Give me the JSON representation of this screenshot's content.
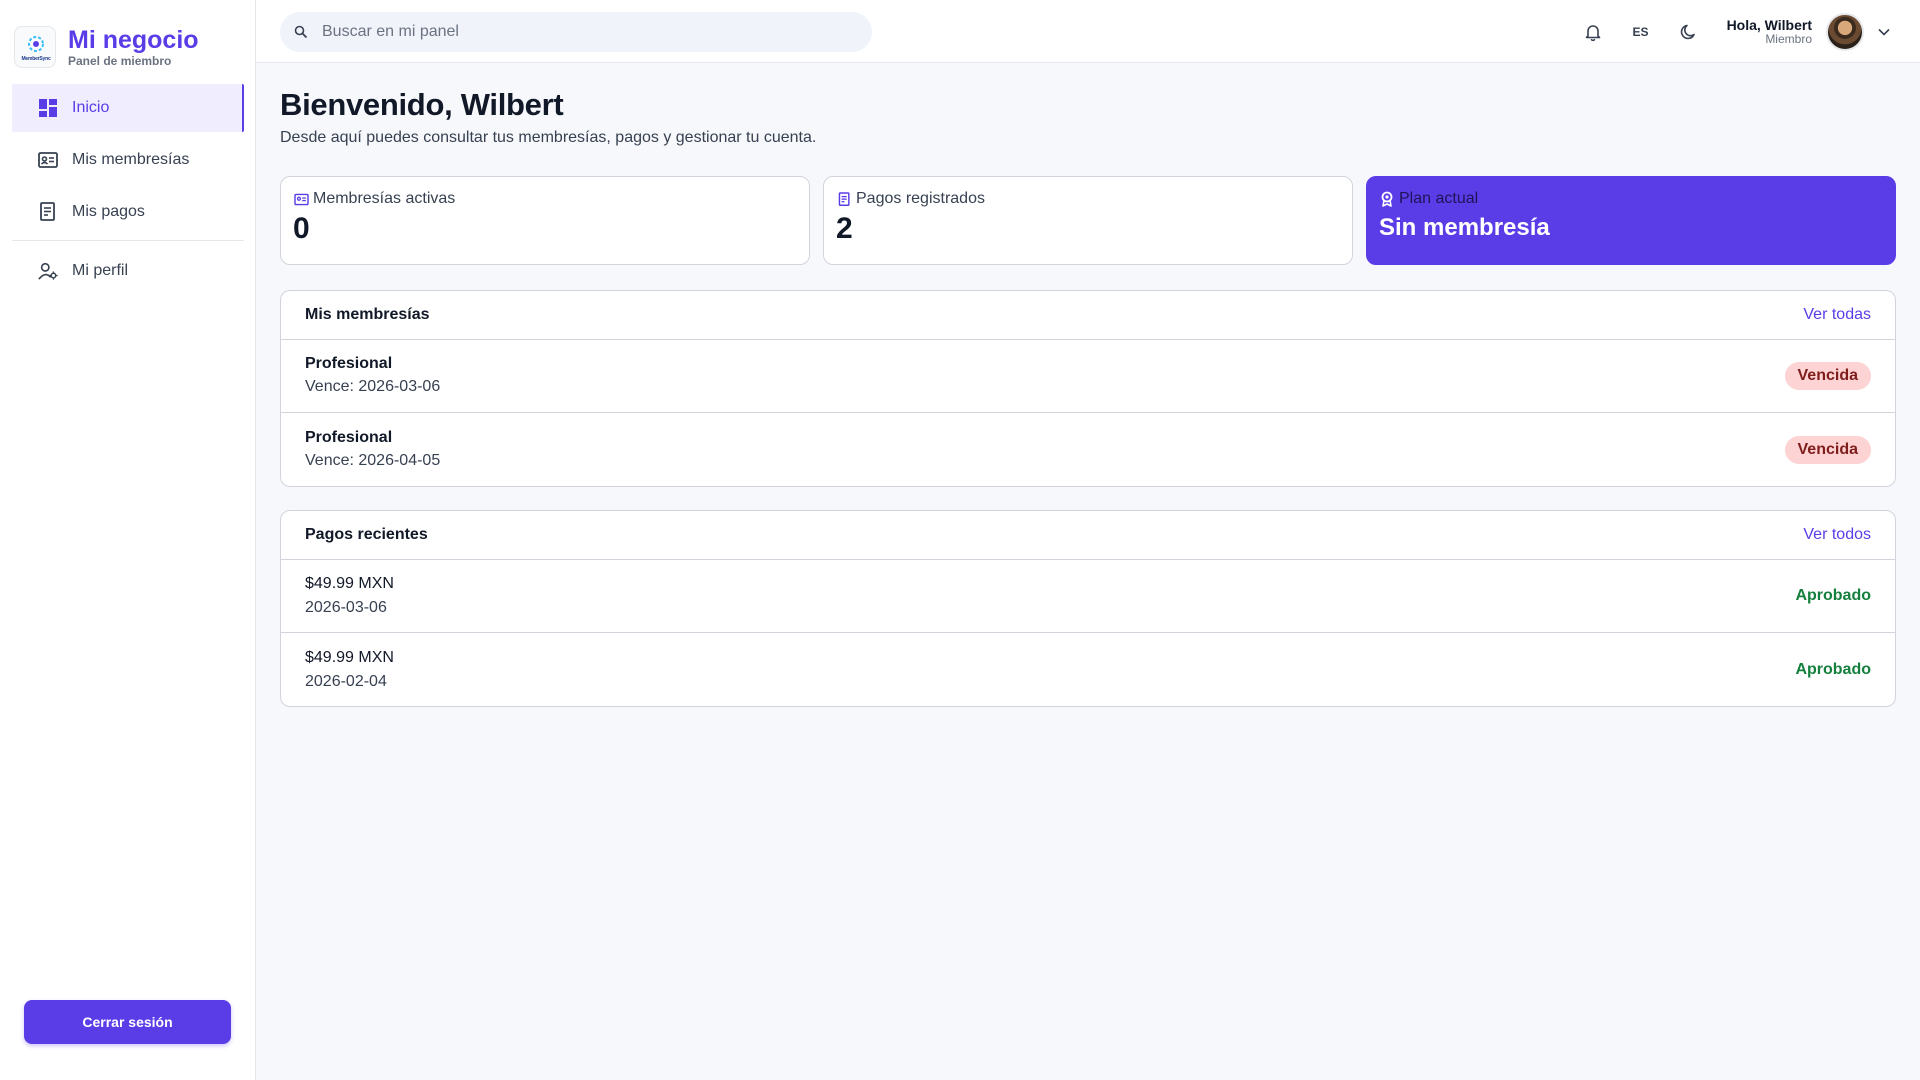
{
  "brand": {
    "title": "Mi negocio",
    "subtitle": "Panel de miembro",
    "logo_text": "MemberSync"
  },
  "sidebar": {
    "items": [
      {
        "label": "Inicio",
        "icon": "dashboard-icon",
        "active": true
      },
      {
        "label": "Mis membresías",
        "icon": "id-card-icon"
      },
      {
        "label": "Mis pagos",
        "icon": "receipt-icon"
      },
      {
        "label": "Mi perfil",
        "icon": "user-settings-icon"
      }
    ],
    "logout_label": "Cerrar sesión"
  },
  "topbar": {
    "search_placeholder": "Buscar en mi panel",
    "language": "ES",
    "user_greeting": "Hola, Wilbert",
    "user_role": "Miembro"
  },
  "page": {
    "title": "Bienvenido, Wilbert",
    "subtitle": "Desde aquí puedes consultar tus membresías, pagos y gestionar tu cuenta."
  },
  "stats": [
    {
      "label": "Membresías activas",
      "value": "0",
      "icon": "id-card-icon"
    },
    {
      "label": "Pagos registrados",
      "value": "2",
      "icon": "receipt-icon"
    },
    {
      "label": "Plan actual",
      "value": "Sin membresía",
      "icon": "award-icon"
    }
  ],
  "memberships": {
    "title": "Mis membresías",
    "link": "Ver todas",
    "rows": [
      {
        "name": "Profesional",
        "expires": "Vence: 2026-03-06",
        "status": "Vencida"
      },
      {
        "name": "Profesional",
        "expires": "Vence: 2026-04-05",
        "status": "Vencida"
      }
    ]
  },
  "payments": {
    "title": "Pagos recientes",
    "link": "Ver todos",
    "rows": [
      {
        "amount": "$49.99 MXN",
        "date": "2026-03-06",
        "status": "Aprobado"
      },
      {
        "amount": "$49.99 MXN",
        "date": "2026-02-04",
        "status": "Aprobado"
      }
    ]
  },
  "colors": {
    "primary": "#5b3de8",
    "danger_bg": "#fdd3d3",
    "success": "#15803d"
  }
}
